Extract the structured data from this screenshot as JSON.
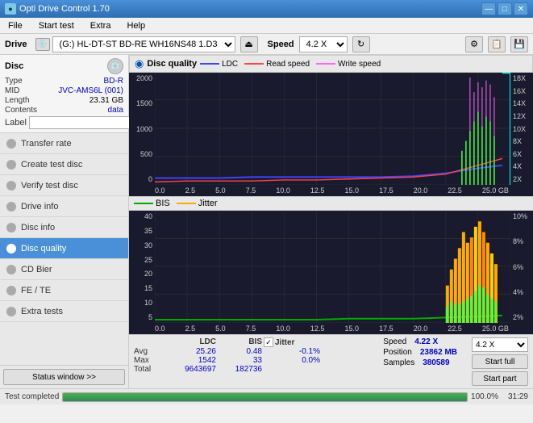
{
  "titleBar": {
    "title": "Opti Drive Control 1.70",
    "icon": "●",
    "minimizeLabel": "—",
    "maximizeLabel": "□",
    "closeLabel": "✕"
  },
  "menuBar": {
    "items": [
      "File",
      "Start test",
      "Extra",
      "Help"
    ]
  },
  "driveToolbar": {
    "driveLabel": "Drive",
    "driveValue": "(G:) HL-DT-ST BD-RE  WH16NS48 1.D3",
    "speedLabel": "Speed",
    "speedValue": "4.2 X"
  },
  "disc": {
    "title": "Disc",
    "typeLabel": "Type",
    "typeValue": "BD-R",
    "midLabel": "MID",
    "midValue": "JVC-AMS6L (001)",
    "lengthLabel": "Length",
    "lengthValue": "23.31 GB",
    "contentsLabel": "Contents",
    "contentsValue": "data",
    "labelLabel": "Label"
  },
  "nav": {
    "items": [
      {
        "id": "transfer-rate",
        "label": "Transfer rate",
        "active": false
      },
      {
        "id": "create-test-disc",
        "label": "Create test disc",
        "active": false
      },
      {
        "id": "verify-test-disc",
        "label": "Verify test disc",
        "active": false
      },
      {
        "id": "drive-info",
        "label": "Drive info",
        "active": false
      },
      {
        "id": "disc-info",
        "label": "Disc info",
        "active": false
      },
      {
        "id": "disc-quality",
        "label": "Disc quality",
        "active": true
      },
      {
        "id": "cd-bier",
        "label": "CD Bier",
        "active": false
      },
      {
        "id": "fe-te",
        "label": "FE / TE",
        "active": false
      },
      {
        "id": "extra-tests",
        "label": "Extra tests",
        "active": false
      }
    ]
  },
  "chartTitle": {
    "title": "Disc quality",
    "icon": "◉",
    "legend": [
      {
        "color": "#4444ff",
        "label": "LDC"
      },
      {
        "color": "#ff0000",
        "label": "Read speed"
      },
      {
        "color": "#ff66ff",
        "label": "Write speed"
      }
    ]
  },
  "chart1": {
    "yAxisLeft": [
      "2000",
      "1500",
      "1000",
      "500",
      "0"
    ],
    "yAxisRight": [
      "18X",
      "16X",
      "14X",
      "12X",
      "10X",
      "8X",
      "6X",
      "4X",
      "2X"
    ],
    "xAxisLabels": [
      "0.0",
      "2.5",
      "5.0",
      "7.5",
      "10.0",
      "12.5",
      "15.0",
      "17.5",
      "20.0",
      "22.5",
      "25.0"
    ],
    "xAxisUnit": "GB"
  },
  "chart2": {
    "title": "BIS",
    "legendItems": [
      {
        "color": "#00aa00",
        "label": "BIS"
      },
      {
        "color": "#ffaa00",
        "label": "Jitter"
      }
    ],
    "yAxisLeft": [
      "40",
      "35",
      "30",
      "25",
      "20",
      "15",
      "10",
      "5"
    ],
    "yAxisRight": [
      "10%",
      "8%",
      "6%",
      "4%",
      "2%"
    ],
    "xAxisLabels": [
      "0.0",
      "2.5",
      "5.0",
      "7.5",
      "10.0",
      "12.5",
      "15.0",
      "17.5",
      "20.0",
      "22.5",
      "25.0"
    ],
    "xAxisUnit": "GB"
  },
  "stats": {
    "ldcLabel": "LDC",
    "bisLabel": "BIS",
    "jitterLabel": "Jitter",
    "avgLabel": "Avg",
    "maxLabel": "Max",
    "totalLabel": "Total",
    "ldcAvg": "25.26",
    "ldcMax": "1542",
    "ldcTotal": "9643697",
    "bisAvg": "0.48",
    "bisMax": "33",
    "bisTotal": "182736",
    "jitterAvg": "-0.1%",
    "jitterMax": "0.0%",
    "speedLabel": "Speed",
    "speedValue": "4.22 X",
    "positionLabel": "Position",
    "positionValue": "23862 MB",
    "samplesLabel": "Samples",
    "samplesValue": "380589",
    "speedSelectValue": "4.2 X",
    "startFullLabel": "Start full",
    "startPartLabel": "Start part"
  },
  "statusBar": {
    "buttonLabel": "Status window >>",
    "statusText": "Test completed",
    "progressPercent": 100,
    "progressLabel": "100.0%",
    "time": "31:29"
  },
  "colors": {
    "accent": "#4a90d9",
    "activeNav": "#4a90d9",
    "chartBg": "#1a1a2e",
    "gridLine": "#444",
    "ldcColor": "#4444ff",
    "readSpeedColor": "#ff4444",
    "writeSpeedColor": "#ff66ff",
    "bisColor": "#00aa00",
    "jitterColor": "#ffaa00"
  }
}
